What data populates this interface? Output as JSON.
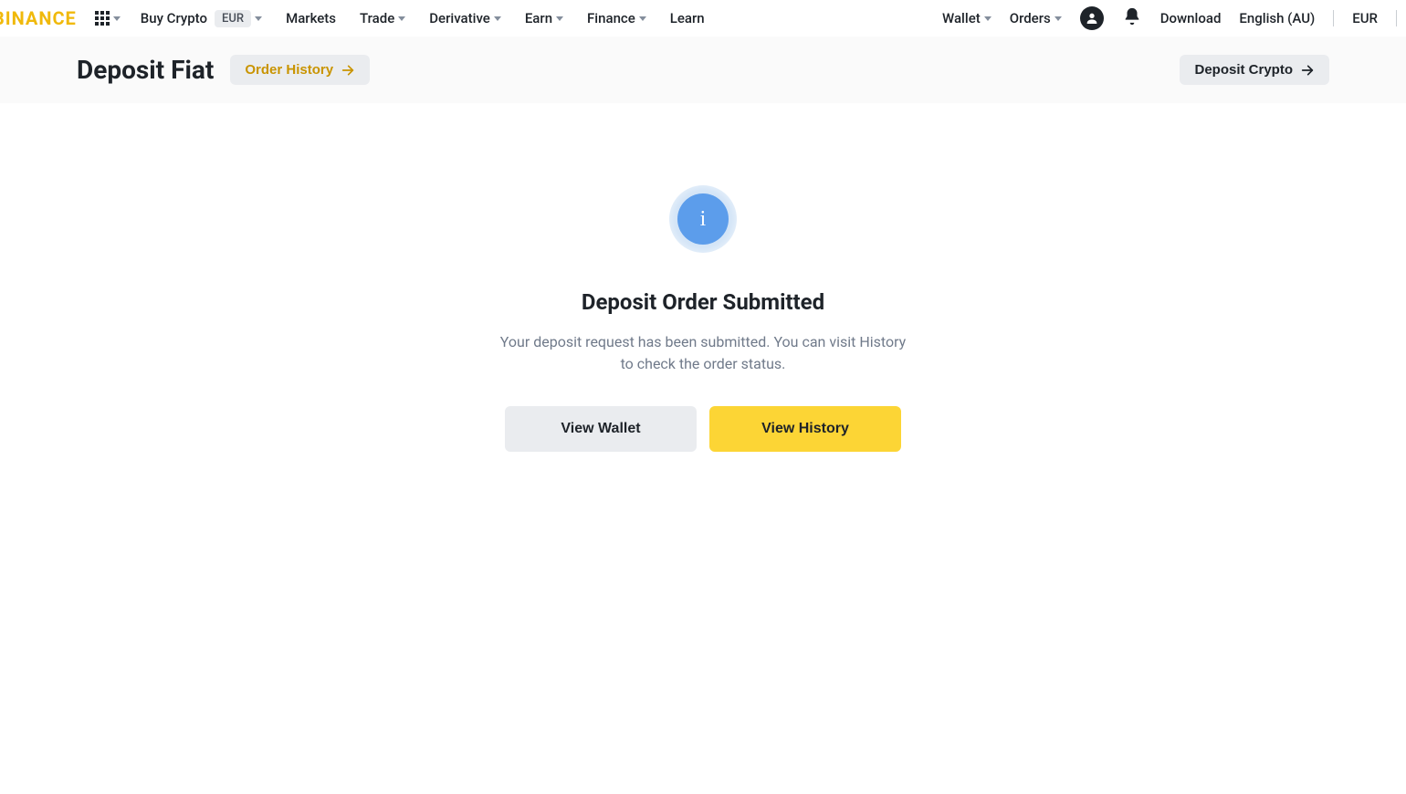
{
  "header": {
    "logo": "BINANCE",
    "nav_left": {
      "buy_crypto": "Buy Crypto",
      "buy_crypto_currency": "EUR",
      "markets": "Markets",
      "trade": "Trade",
      "derivative": "Derivative",
      "earn": "Earn",
      "finance": "Finance",
      "learn": "Learn"
    },
    "nav_right": {
      "wallet": "Wallet",
      "orders": "Orders",
      "download": "Download",
      "language": "English (AU)",
      "currency": "EUR"
    }
  },
  "subheader": {
    "title": "Deposit Fiat",
    "order_history": "Order History",
    "deposit_crypto": "Deposit Crypto"
  },
  "main": {
    "status_title": "Deposit Order Submitted",
    "status_desc": "Your deposit request has been submitted. You can visit History to check the order status.",
    "view_wallet": "View Wallet",
    "view_history": "View History"
  }
}
